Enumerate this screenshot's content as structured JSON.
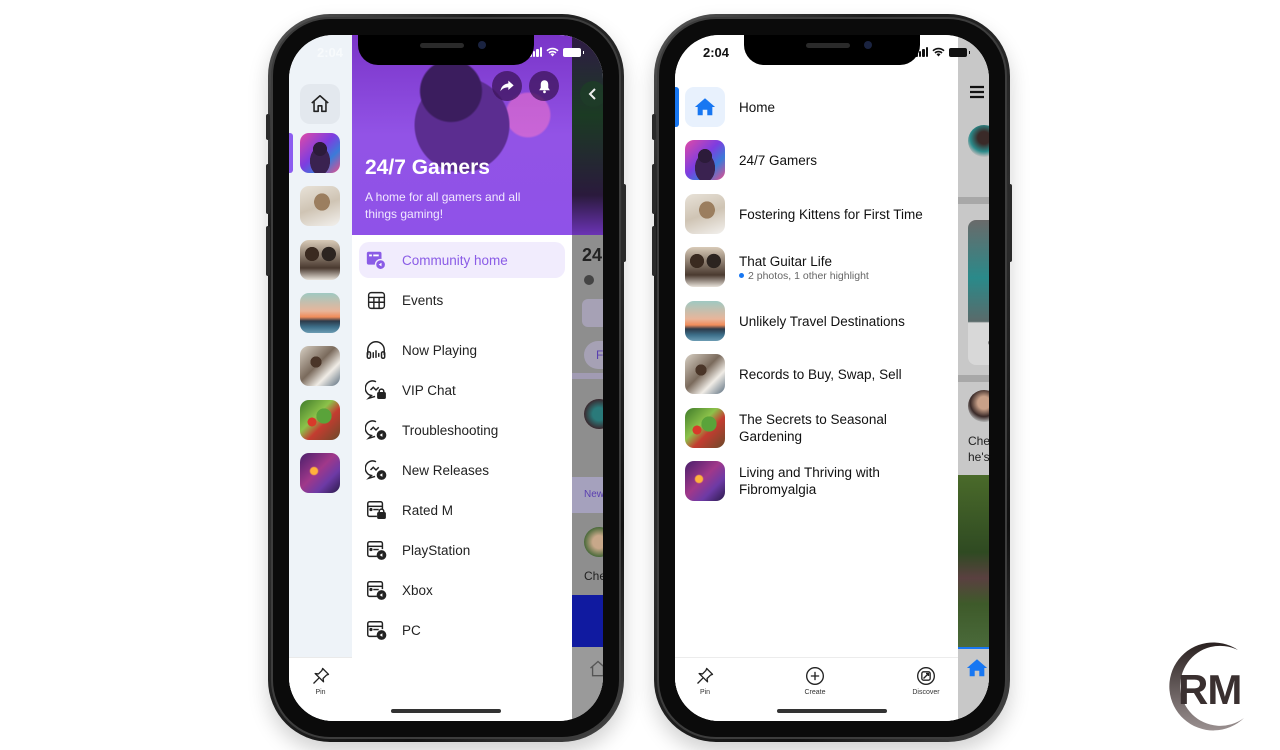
{
  "left_phone": {
    "status_time": "2:04",
    "rail": {
      "home_label": "Home",
      "pin_label": "Pin",
      "communities": [
        {
          "name": "24/7 Gamers",
          "photo": "gamer",
          "active": true
        },
        {
          "name": "Fostering Kittens for First Time",
          "photo": "kitten"
        },
        {
          "name": "That Guitar Life",
          "photo": "guitar"
        },
        {
          "name": "Unlikely Travel Destinations",
          "photo": "travel"
        },
        {
          "name": "Records to Buy, Swap, Sell",
          "photo": "records"
        },
        {
          "name": "The Secrets to Seasonal Gardening",
          "photo": "garden"
        },
        {
          "name": "Living and Thriving with Fibromyalgia",
          "photo": "fibro"
        }
      ]
    },
    "drawer": {
      "title": "24/7 Gamers",
      "subtitle": "A home for all gamers and all things gaming!",
      "share_icon": "share-icon",
      "notify_icon": "bell-icon",
      "menu": [
        {
          "label": "Community home",
          "icon": "community-home-icon",
          "active": true
        },
        {
          "label": "Events",
          "icon": "calendar-grid-icon"
        },
        {
          "label": "Now Playing",
          "icon": "headphones-icon"
        },
        {
          "label": "VIP Chat",
          "icon": "chat-lock-icon"
        },
        {
          "label": "Troubleshooting",
          "icon": "chat-globe-icon"
        },
        {
          "label": "New Releases",
          "icon": "chat-globe-icon"
        },
        {
          "label": "Rated M",
          "icon": "feed-lock-icon"
        },
        {
          "label": "PlayStation",
          "icon": "feed-globe-icon"
        },
        {
          "label": "Xbox",
          "icon": "feed-globe-icon"
        },
        {
          "label": "PC",
          "icon": "feed-globe-icon"
        }
      ]
    },
    "behind": {
      "title_fragment": "24",
      "chip_fragment": "F",
      "tag_fragment": "New",
      "name_fragment": "Che"
    }
  },
  "right_phone": {
    "status_time": "2:04",
    "list": [
      {
        "title": "Home",
        "photo": "home",
        "active": true
      },
      {
        "title": "24/7 Gamers",
        "photo": "gamer"
      },
      {
        "title": "Fostering Kittens for First Time",
        "photo": "kitten"
      },
      {
        "title": "That Guitar Life",
        "subtitle": "2 photos, 1 other highlight",
        "photo": "guitar"
      },
      {
        "title": "Unlikely Travel Destinations",
        "photo": "travel"
      },
      {
        "title": "Records to Buy, Swap, Sell",
        "photo": "records"
      },
      {
        "title": "The Secrets to Seasonal Gardening",
        "photo": "garden"
      },
      {
        "title": "Living and Thriving with Fibromyalgia",
        "photo": "fibro"
      }
    ],
    "tabs": [
      {
        "label": "Pin",
        "icon": "pin-icon"
      },
      {
        "label": "Create",
        "icon": "plus-circle-icon"
      },
      {
        "label": "Discover",
        "icon": "discover-icon"
      }
    ],
    "behind": {
      "text_line1": "Che",
      "text_line2": "he's",
      "text_fragment": "c"
    }
  },
  "watermark": {
    "text": "RM"
  },
  "colors": {
    "accent_purple": "#8a5ce6",
    "accent_blue": "#1877f2",
    "hero_purple": "#9253e6"
  }
}
